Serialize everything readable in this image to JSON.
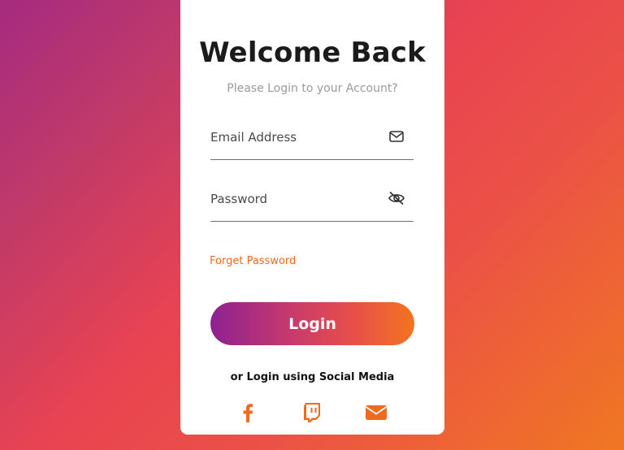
{
  "form": {
    "title": "Welcome Back",
    "subtitle": "Please Login to your Account?",
    "email_placeholder": "Email Address",
    "password_placeholder": "Password",
    "forgot_label": "Forget Password",
    "login_label": "Login",
    "social_caption": "or Login using Social Media"
  },
  "icons": {
    "email_field": "envelope-icon",
    "password_field": "eye-slash-icon",
    "social": [
      "facebook-icon",
      "twitch-icon",
      "envelope-icon"
    ]
  },
  "colors": {
    "accent": "#ee6a1d",
    "gradient_start": "#8e2190",
    "gradient_end": "#f2741f"
  }
}
